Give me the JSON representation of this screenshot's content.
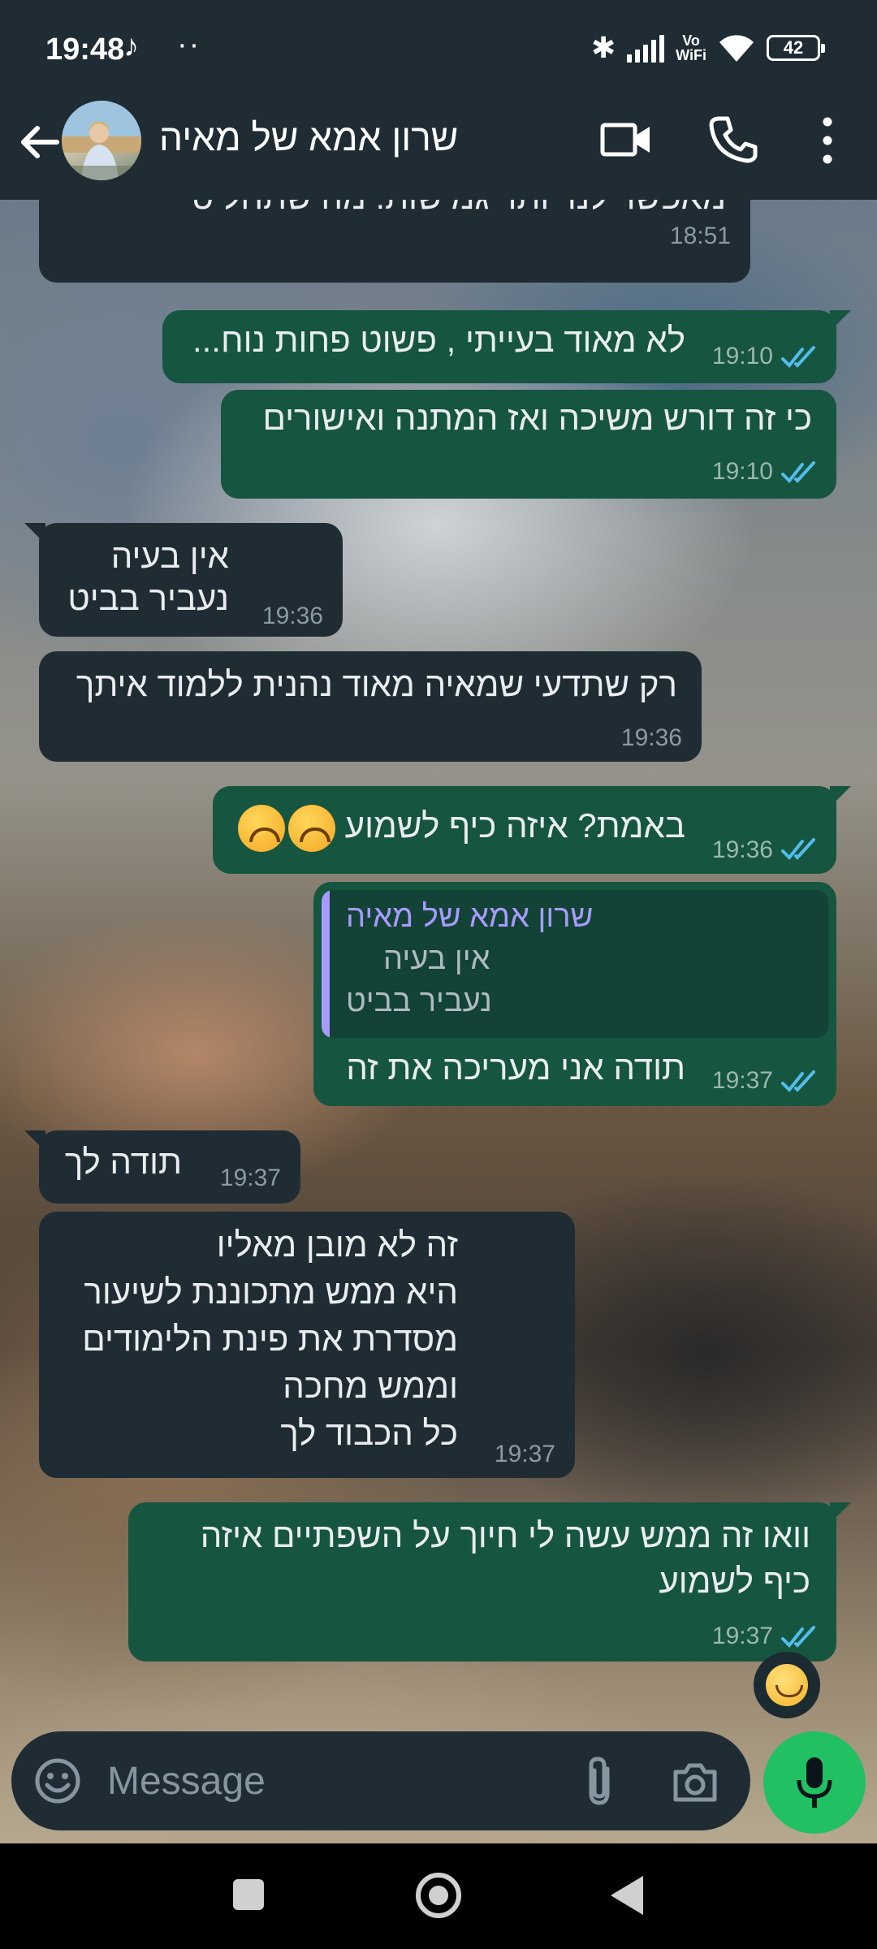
{
  "status_bar": {
    "time": "19:48",
    "tiktok_glyph": "♪",
    "dots": "··",
    "vowifi_line1": "Vo",
    "vowifi_line2": "WiFi",
    "battery": "42",
    "bluetooth_glyph": "✱"
  },
  "header": {
    "contact_name": "שרון אמא של מאיה",
    "icons": [
      "back-arrow-icon",
      "video-call-icon",
      "voice-call-icon",
      "more-vert-icon"
    ]
  },
  "messages": [
    {
      "direction": "in",
      "lines": [
        "מאפשר לנו יותר גמישות. מה שתחליטי"
      ],
      "time": "18:51"
    },
    {
      "direction": "out",
      "lines": [
        "לא מאוד בעייתי , פשוט פחות נוח..."
      ],
      "time": "19:10",
      "read": true
    },
    {
      "direction": "out",
      "lines": [
        "כי זה דורש משיכה ואז המתנה ואישורים"
      ],
      "time": "19:10",
      "read": true
    },
    {
      "direction": "in",
      "lines": [
        "אין בעיה",
        "נעביר בביט"
      ],
      "time": "19:36"
    },
    {
      "direction": "in",
      "lines": [
        "רק שתדעי שמאיה מאוד נהנית ללמוד איתך"
      ],
      "time": "19:36"
    },
    {
      "direction": "out",
      "lines": [
        "באמת? איזה כיף לשמוע"
      ],
      "emoji": [
        "upside-down-face",
        "upside-down-face"
      ],
      "time": "19:36",
      "read": true
    },
    {
      "direction": "out",
      "quote": {
        "author": "שרון אמא של מאיה",
        "lines": [
          "אין בעיה",
          "נעביר בביט"
        ]
      },
      "lines": [
        "תודה אני מעריכה את זה"
      ],
      "time": "19:37",
      "read": true
    },
    {
      "direction": "in",
      "lines": [
        "תודה לך"
      ],
      "time": "19:37"
    },
    {
      "direction": "in",
      "lines": [
        "זה לא מובן מאליו",
        "היא ממש מתכוננת לשיעור",
        "מסדרת את פינת הלימודים",
        "וממש מחכה",
        "כל הכבוד לך"
      ],
      "time": "19:37"
    },
    {
      "direction": "out",
      "lines": [
        "וואו זה ממש עשה לי חיוך על השפתיים איזה",
        "כיף לשמוע"
      ],
      "time": "19:37",
      "read": true,
      "reaction": "smiling-face"
    }
  ],
  "input": {
    "placeholder": "Message"
  },
  "colors": {
    "header_bg": "#1f2c34",
    "incoming_bubble": "#202c33",
    "outgoing_bubble": "#16553f",
    "read_ticks": "#53bdeb",
    "quote_accent": "#a89bff",
    "mic_button": "#21c063"
  }
}
